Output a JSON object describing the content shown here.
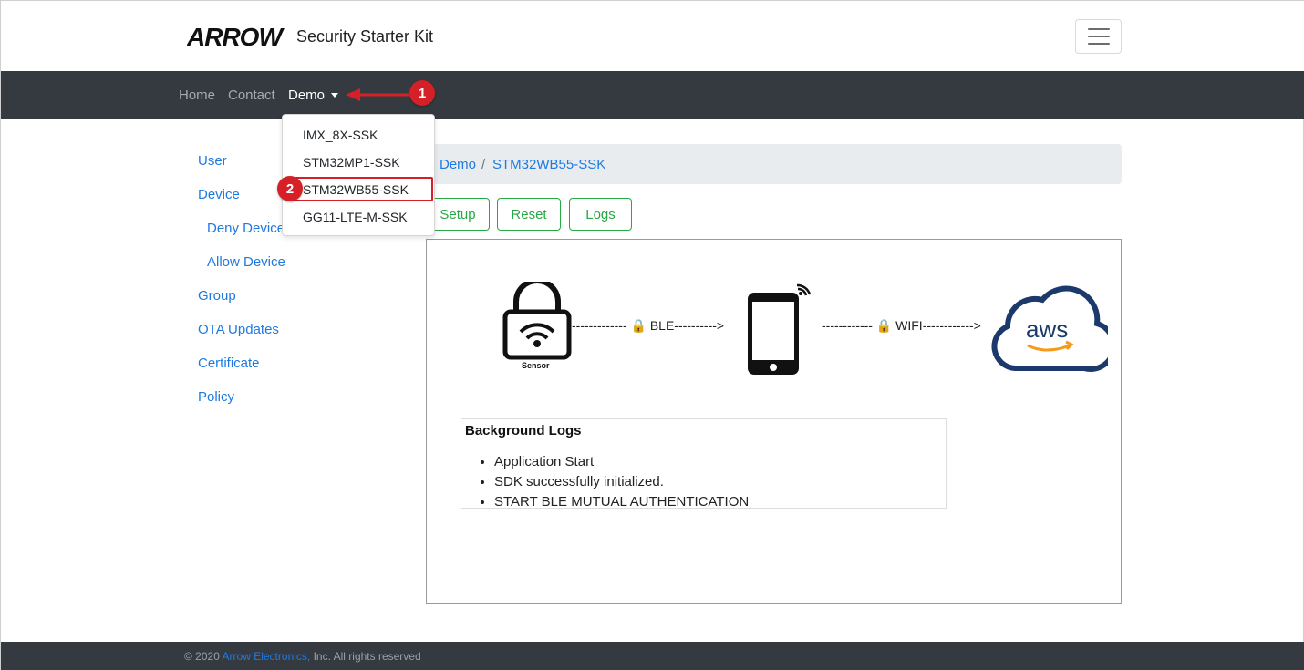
{
  "header": {
    "logo_text": "ARROW",
    "title": "Security Starter Kit"
  },
  "nav": {
    "home": "Home",
    "contact": "Contact",
    "demo": "Demo"
  },
  "dropdown": {
    "items": [
      "IMX_8X-SSK",
      "STM32MP1-SSK",
      "STM32WB55-SSK",
      "GG11-LTE-M-SSK"
    ],
    "highlighted": "STM32WB55-SSK"
  },
  "annotations": {
    "step1": "1",
    "step2": "2",
    "color": "#d42026"
  },
  "sidebar": {
    "items": [
      {
        "label": "User"
      },
      {
        "label": "Device"
      },
      {
        "label": "Deny Device"
      },
      {
        "label": "Allow Device"
      },
      {
        "label": "Group"
      },
      {
        "label": "OTA Updates"
      },
      {
        "label": "Certificate"
      },
      {
        "label": "Policy"
      }
    ]
  },
  "breadcrumb": {
    "parent": "Demo",
    "separator": "/",
    "current": "STM32WB55-SSK"
  },
  "actions": {
    "setup": "Setup",
    "reset": "Reset",
    "logs": "Logs"
  },
  "diagram": {
    "sensor_label": "Sensor",
    "ble_link": "------------- 🔒 BLE---------->",
    "wifi_link": "------------ 🔒 WIFI------------>",
    "cloud_label": "aws"
  },
  "logs": {
    "title": "Background Logs",
    "entries": [
      "Application Start",
      "SDK successfully initialized.",
      "START BLE MUTUAL AUTHENTICATION"
    ]
  },
  "footer": {
    "copyright": "© 2020",
    "company": "Arrow Electronics,",
    "rights": "Inc. All rights reserved"
  },
  "colors": {
    "navbar": "#343a40",
    "link": "#1f7ae0",
    "success": "#28a745",
    "aws_navy": "#1b3a6b",
    "aws_orange": "#f59b1c"
  }
}
